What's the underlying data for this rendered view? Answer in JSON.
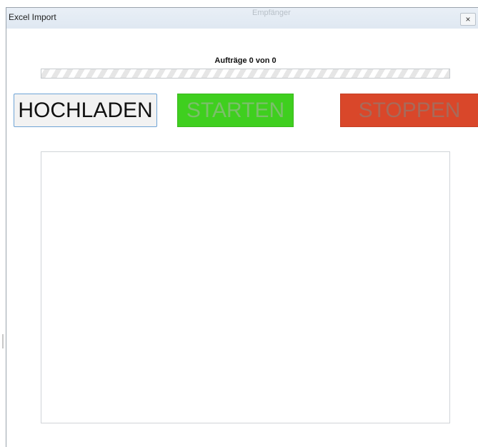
{
  "window": {
    "title": "Excel Import",
    "close_label": "×",
    "background_tab_text": "Empfänger"
  },
  "progress": {
    "label": "Aufträge 0 von 0",
    "completed": 0,
    "total": 0,
    "fraction": 0
  },
  "buttons": {
    "upload_label": "HOCHLADEN",
    "start_label": "STARTEN",
    "stop_label": "STOPPEN"
  },
  "log": {
    "content": ""
  },
  "colors": {
    "start_button": "#3fcf1f",
    "stop_button": "#d9472a",
    "upload_border": "#6ea3d6"
  },
  "icons": {
    "close": "close-icon"
  }
}
